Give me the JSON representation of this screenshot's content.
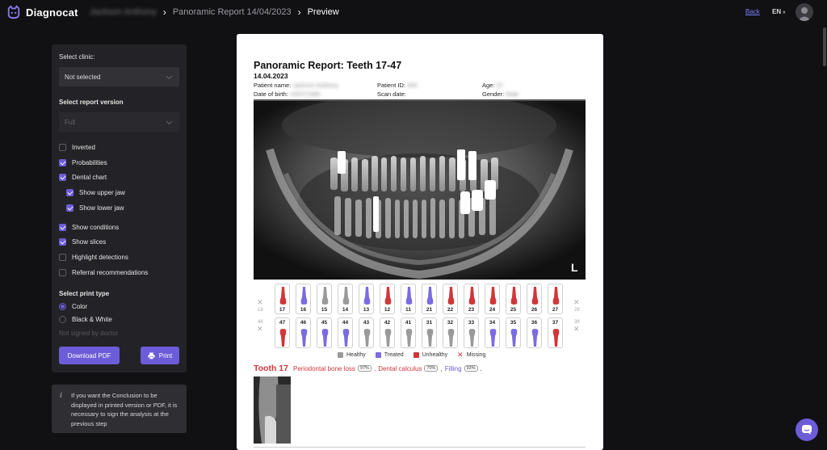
{
  "header": {
    "brand": "Diagnocat",
    "crumb_patient": "Jackson Anthony",
    "crumb_report": "Panoramic Report 14/04/2023",
    "crumb_current": "Preview",
    "back": "Back",
    "lang": "EN"
  },
  "sidebar": {
    "clinic_label": "Select clinic:",
    "clinic_value": "Not selected",
    "version_label": "Select report version",
    "version_value": "Full",
    "options": [
      {
        "label": "Inverted",
        "checked": false
      },
      {
        "label": "Probabilities",
        "checked": true
      },
      {
        "label": "Dental chart",
        "checked": true
      },
      {
        "label": "Show upper jaw",
        "checked": true
      },
      {
        "label": "Show lower jaw",
        "checked": true
      },
      {
        "label": "Show conditions",
        "checked": true
      },
      {
        "label": "Show slices",
        "checked": true
      },
      {
        "label": "Highlight detections",
        "checked": false
      },
      {
        "label": "Referral recommendations",
        "checked": false
      }
    ],
    "print_type_label": "Select print type",
    "print_color": "Color",
    "print_bw": "Black & White",
    "not_signed": "Not signed by doctor",
    "download_pdf": "Download PDF",
    "print": "Print"
  },
  "info": {
    "text": "If you want the Conclusion to be displayed in printed version or PDF, it is necessary to sign the analysis at the previous step"
  },
  "report": {
    "title": "Panoramic Report: Teeth 17-47",
    "date": "14.04.2023",
    "patient_name_label": "Patient name:",
    "patient_name_value": "Jackson Anthony",
    "patient_id_label": "Patient ID:",
    "patient_id_value": "000",
    "age_label": "Age:",
    "age_value": "37",
    "dob_label": "Date of birth:",
    "dob_value": "15/07/1985",
    "scan_date_label": "Scan date:",
    "gender_label": "Gender:",
    "gender_value": "Male",
    "xray_side": "L",
    "upper_teeth": [
      {
        "num": "17",
        "status": "unhealthy"
      },
      {
        "num": "16",
        "status": "treated"
      },
      {
        "num": "15",
        "status": "healthy"
      },
      {
        "num": "14",
        "status": "healthy"
      },
      {
        "num": "13",
        "status": "treated"
      },
      {
        "num": "12",
        "status": "unhealthy"
      },
      {
        "num": "11",
        "status": "treated"
      },
      {
        "num": "21",
        "status": "treated"
      },
      {
        "num": "22",
        "status": "unhealthy"
      },
      {
        "num": "23",
        "status": "unhealthy"
      },
      {
        "num": "24",
        "status": "unhealthy"
      },
      {
        "num": "25",
        "status": "unhealthy"
      },
      {
        "num": "26",
        "status": "unhealthy"
      },
      {
        "num": "27",
        "status": "unhealthy"
      }
    ],
    "lower_teeth": [
      {
        "num": "47",
        "status": "unhealthy"
      },
      {
        "num": "46",
        "status": "treated"
      },
      {
        "num": "45",
        "status": "treated"
      },
      {
        "num": "44",
        "status": "treated"
      },
      {
        "num": "43",
        "status": "healthy"
      },
      {
        "num": "42",
        "status": "healthy"
      },
      {
        "num": "41",
        "status": "healthy"
      },
      {
        "num": "31",
        "status": "healthy"
      },
      {
        "num": "32",
        "status": "healthy"
      },
      {
        "num": "33",
        "status": "healthy"
      },
      {
        "num": "34",
        "status": "treated"
      },
      {
        "num": "35",
        "status": "treated"
      },
      {
        "num": "36",
        "status": "treated"
      },
      {
        "num": "37",
        "status": "unhealthy"
      }
    ],
    "missing_upper": [
      "18",
      "28"
    ],
    "missing_lower": [
      "48",
      "38"
    ],
    "legend": {
      "healthy": "Healthy",
      "treated": "Treated",
      "unhealthy": "Unhealthy",
      "missing": "Missing"
    },
    "finding": {
      "tooth": "Tooth 17",
      "c1": "Periodontal bone loss",
      "p1": "97%",
      "c2": "Dental calculus",
      "p2": "70%",
      "c3": "Filling",
      "p3": "93%"
    }
  },
  "colors": {
    "accent": "#6d5cd8",
    "unhealthy": "#d0363a",
    "treated": "#7b6be0",
    "healthy": "#9a9a9a"
  }
}
